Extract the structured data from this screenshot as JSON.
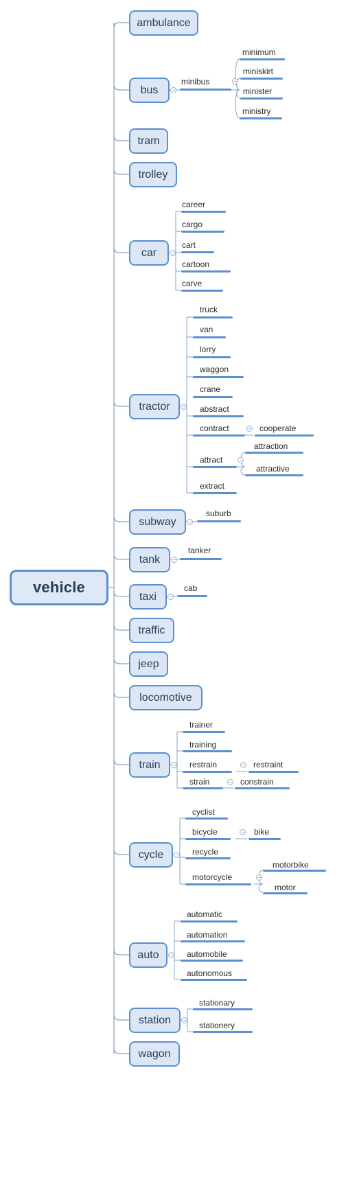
{
  "diagram": {
    "type": "mind-map",
    "title": "vehicle",
    "root": {
      "label": "vehicle"
    },
    "branches": [
      {
        "label": "ambulance",
        "children": []
      },
      {
        "label": "bus",
        "children": [
          {
            "label": "minibus",
            "children": [
              {
                "label": "minimum"
              },
              {
                "label": "miniskirt"
              },
              {
                "label": "minister"
              },
              {
                "label": "ministry"
              }
            ]
          }
        ]
      },
      {
        "label": "tram",
        "children": []
      },
      {
        "label": "trolley",
        "children": []
      },
      {
        "label": "car",
        "children": [
          {
            "label": "career"
          },
          {
            "label": "cargo"
          },
          {
            "label": "cart"
          },
          {
            "label": "cartoon"
          },
          {
            "label": "carve"
          }
        ]
      },
      {
        "label": "tractor",
        "children": [
          {
            "label": "truck"
          },
          {
            "label": "van"
          },
          {
            "label": "lorry"
          },
          {
            "label": "waggon"
          },
          {
            "label": "crane"
          },
          {
            "label": "abstract"
          },
          {
            "label": "contract",
            "children": [
              {
                "label": "cooperate"
              }
            ]
          },
          {
            "label": "attract",
            "children": [
              {
                "label": "attraction"
              },
              {
                "label": "attractive"
              }
            ]
          },
          {
            "label": "extract"
          }
        ]
      },
      {
        "label": "subway",
        "children": [
          {
            "label": "suburb"
          }
        ]
      },
      {
        "label": "tank",
        "children": [
          {
            "label": "tanker"
          }
        ]
      },
      {
        "label": "taxi",
        "children": [
          {
            "label": "cab"
          }
        ]
      },
      {
        "label": "traffic",
        "children": []
      },
      {
        "label": "jeep",
        "children": []
      },
      {
        "label": "locomotive",
        "children": []
      },
      {
        "label": "train",
        "children": [
          {
            "label": "trainer"
          },
          {
            "label": "training"
          },
          {
            "label": "restrain",
            "children": [
              {
                "label": "restraint"
              }
            ]
          },
          {
            "label": "strain",
            "children": [
              {
                "label": "constrain"
              }
            ]
          }
        ]
      },
      {
        "label": "cycle",
        "children": [
          {
            "label": "cyclist"
          },
          {
            "label": "bicycle",
            "children": [
              {
                "label": "bike"
              }
            ]
          },
          {
            "label": "recycle"
          },
          {
            "label": "motorcycle",
            "children": [
              {
                "label": "motorbike"
              },
              {
                "label": "motor"
              }
            ]
          }
        ]
      },
      {
        "label": "auto",
        "children": [
          {
            "label": "automatic"
          },
          {
            "label": "automation"
          },
          {
            "label": "automobile"
          },
          {
            "label": "autonomous"
          }
        ]
      },
      {
        "label": "station",
        "children": [
          {
            "label": "stationary"
          },
          {
            "label": "stationery"
          }
        ]
      },
      {
        "label": "wagon",
        "children": []
      }
    ],
    "colors": {
      "node_fill": "#dce6f4",
      "node_border": "#5b8fce",
      "node_text": "#28415e",
      "underline": "#5b8fce",
      "connector": "#6e8cb0",
      "leaf_text": "#2b2b2b",
      "background": "#ffffff"
    },
    "icons": {
      "collapse": "collapse-minus-icon"
    }
  }
}
